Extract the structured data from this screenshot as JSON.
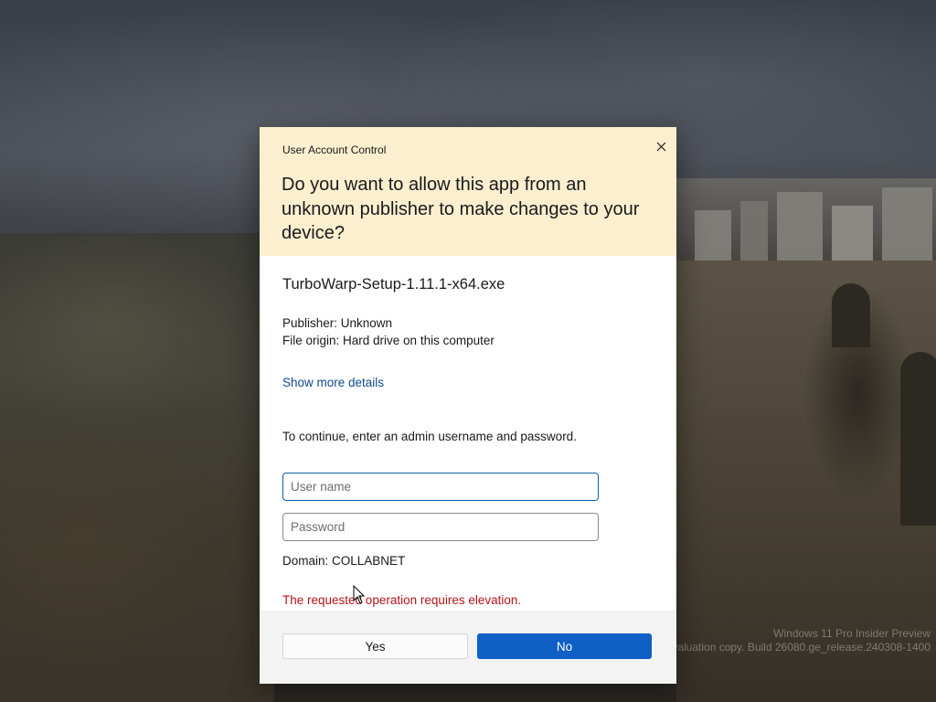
{
  "desktop": {
    "watermark_line1": "Windows 11 Pro Insider Preview",
    "watermark_line2": "Evaluation copy. Build 26080.ge_release.240308-1400"
  },
  "uac": {
    "window_title": "User Account Control",
    "close_icon": "close-icon",
    "headline": "Do you want to allow this app from an unknown publisher to make changes to your device?",
    "app_name": "TurboWarp-Setup-1.11.1-x64.exe",
    "publisher": "Publisher: Unknown",
    "file_origin": "File origin: Hard drive on this computer",
    "more_details_link": "Show more details",
    "credentials_prompt": "To continue, enter an admin username and password.",
    "username_placeholder": "User name",
    "username_value": "",
    "password_placeholder": "Password",
    "password_value": "",
    "domain": "Domain: COLLABNET",
    "error_message": "The requested operation requires elevation.",
    "yes_label": "Yes",
    "no_label": "No"
  },
  "colors": {
    "header_bg": "#fcefd0",
    "primary_button": "#0f5fc5",
    "link": "#0f4a8a",
    "error": "#b3141a"
  }
}
